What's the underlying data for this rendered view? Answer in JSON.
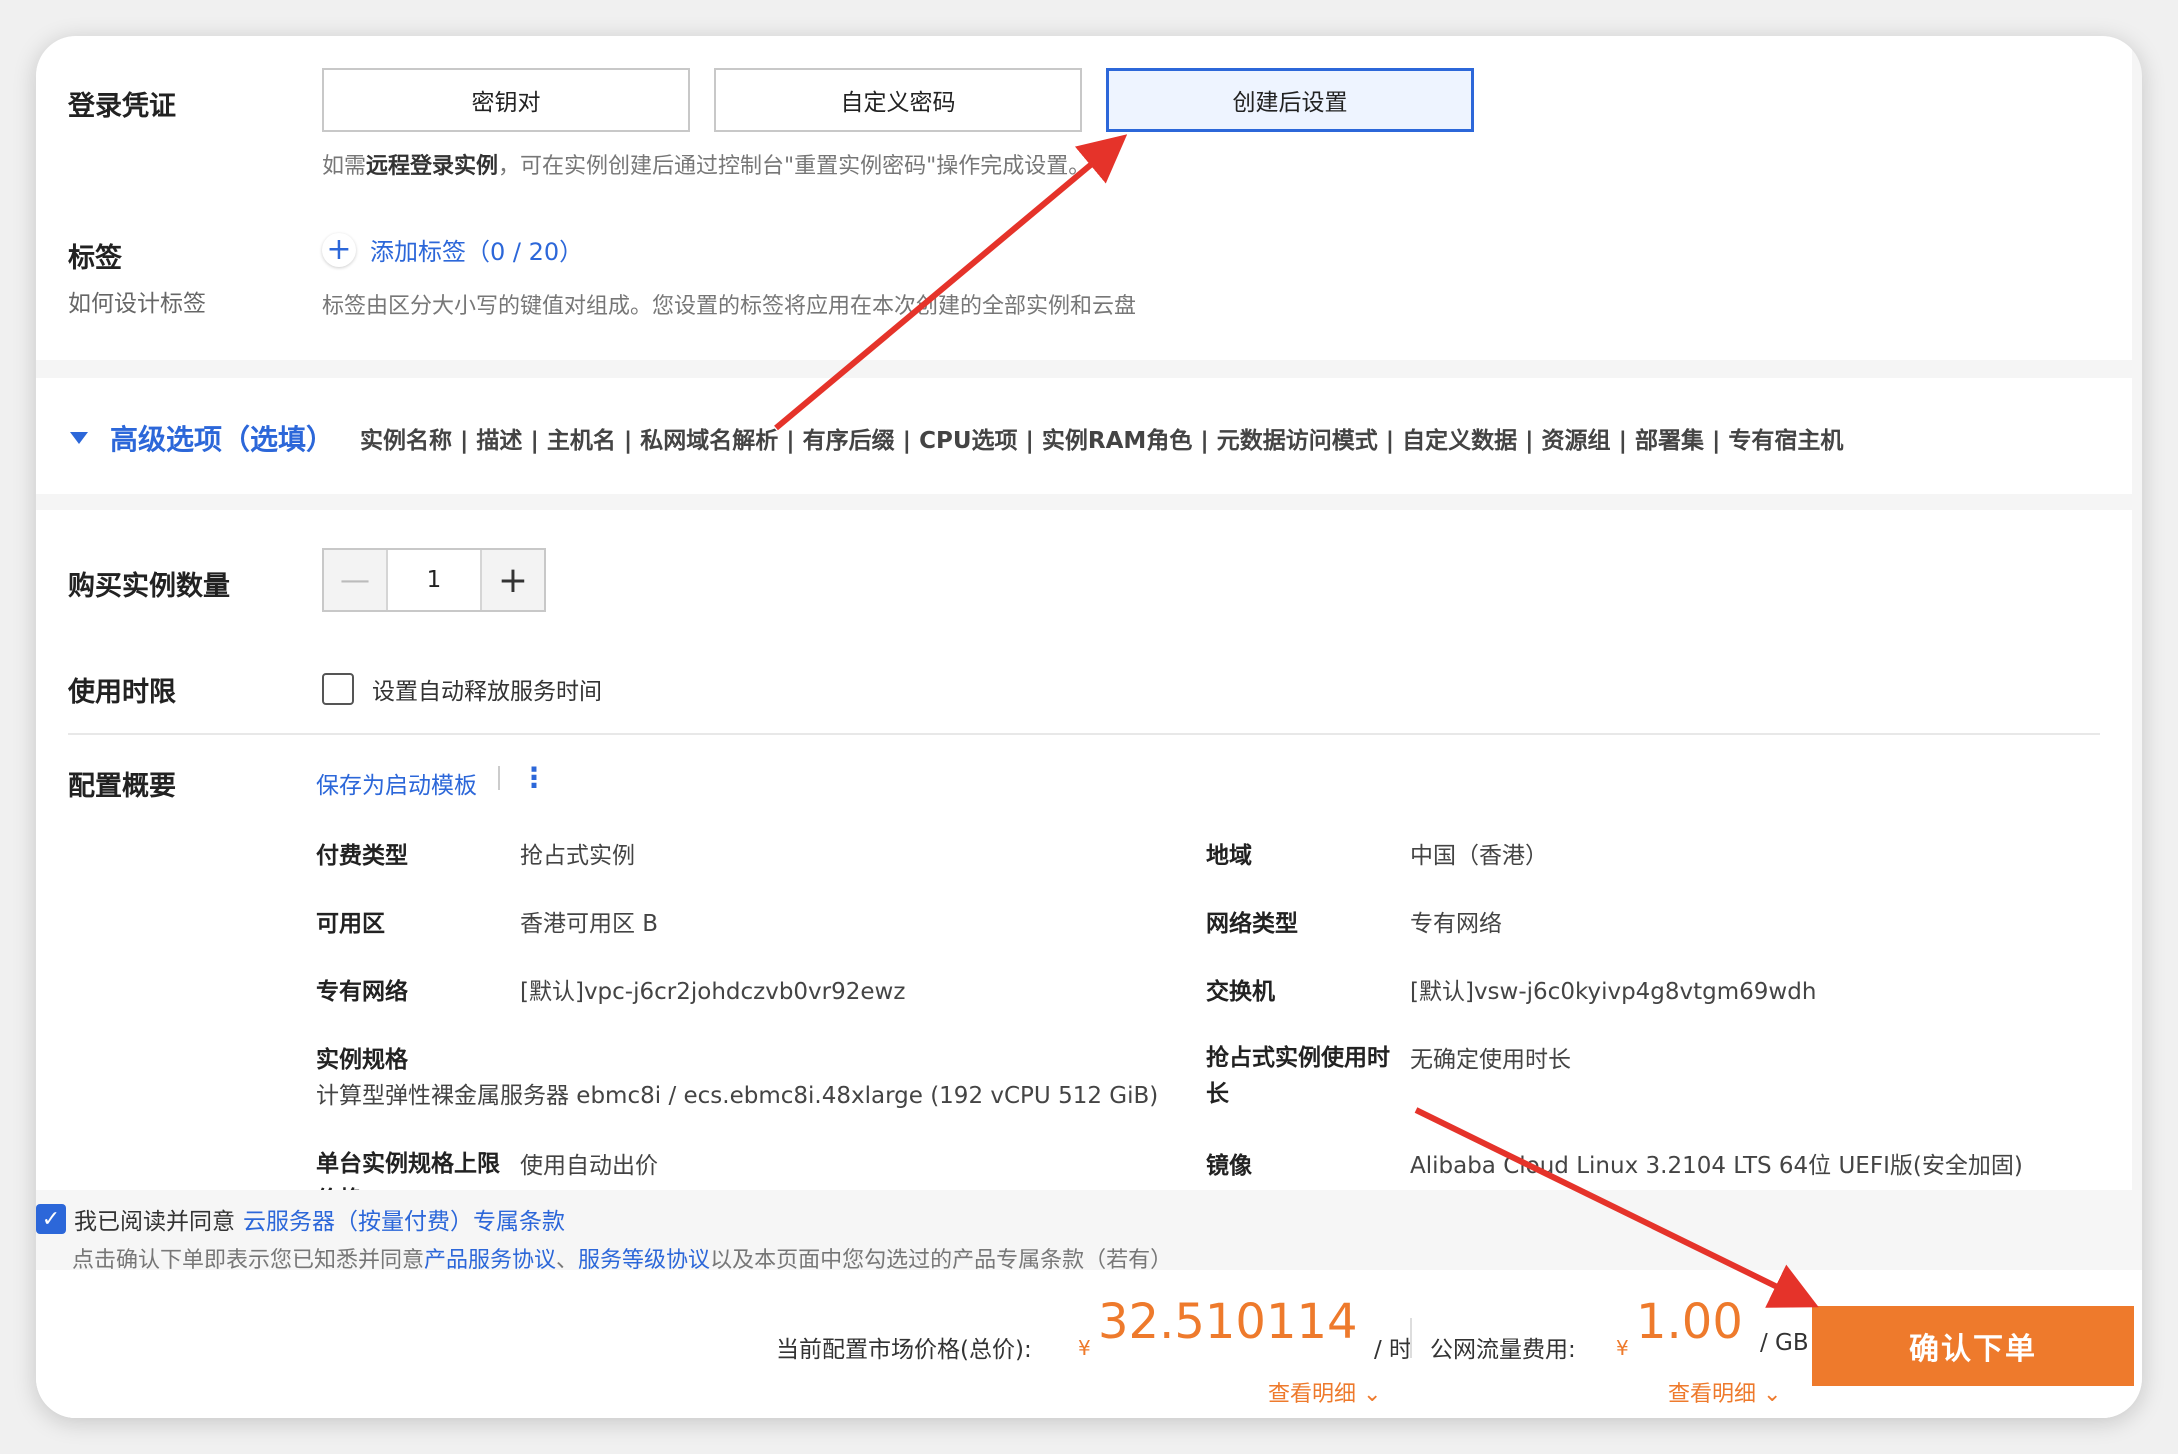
{
  "login": {
    "label": "登录凭证",
    "options": [
      "密钥对",
      "自定义密码",
      "创建后设置"
    ],
    "hint_prefix": "如需",
    "hint_bold": "远程登录实例",
    "hint_suffix": "，可在实例创建后通过控制台\"重置实例密码\"操作完成设置。"
  },
  "tags": {
    "label": "标签",
    "sublabel": "如何设计标签",
    "add_label": "添加标签（0 / 20）",
    "hint": "标签由区分大小写的键值对组成。您设置的标签将应用在本次创建的全部实例和云盘"
  },
  "advanced": {
    "title": "高级选项（选填）",
    "items": "实例名称 | 描述 | 主机名 | 私网域名解析 | 有序后缀 | CPU选项 | 实例RAM角色 | 元数据访问模式 | 自定义数据 | 资源组 | 部署集 | 专有宿主机"
  },
  "quantity": {
    "label": "购买实例数量",
    "value": "1"
  },
  "duration": {
    "label": "使用时限",
    "checkbox_label": "设置自动释放服务时间"
  },
  "summary": {
    "label": "配置概要",
    "save_template": "保存为启动模板",
    "more": "⋮",
    "rows": [
      {
        "k": "付费类型",
        "v": "抢占式实例"
      },
      {
        "k": "地域",
        "v": "中国（香港）"
      },
      {
        "k": "可用区",
        "v": "香港可用区 B"
      },
      {
        "k": "网络类型",
        "v": "专有网络"
      },
      {
        "k": "专有网络",
        "v": "[默认]vpc-j6cr2johdczvb0vr92ewz"
      },
      {
        "k": "交换机",
        "v": "[默认]vsw-j6c0kyivp4g8vtgm69wdh"
      },
      {
        "k": "实例规格",
        "v": "计算型弹性裸金属服务器 ebmc8i / ecs.ebmc8i.48xlarge (192 vCPU 512 GiB)"
      },
      {
        "k": "抢占式实例使用时长",
        "v": "无确定使用时长"
      },
      {
        "k": "单台实例规格上限价格",
        "v": "使用自动出价"
      },
      {
        "k": "镜像",
        "v": "Alibaba Cloud Linux 3.2104 LTS 64位 UEFI版(安全加固)"
      }
    ]
  },
  "agreement": {
    "prefix": "我已阅读并同意",
    "link": "云服务器（按量付费）专属条款",
    "note_prefix": "点击确认下单即表示您已知悉并同意",
    "note_link1": "产品服务协议",
    "note_sep": "、",
    "note_link2": "服务等级协议",
    "note_suffix": "以及本页面中您勾选过的产品专属条款（若有）"
  },
  "footer": {
    "price_label": "当前配置市场价格(总价):",
    "currency": "¥",
    "price": "32.510114",
    "price_unit": "/ 时",
    "traffic_label": "公网流量费用:",
    "traffic_price": "1.00",
    "traffic_unit": "/ GB",
    "detail": "查看明细 ⌄",
    "confirm": "确认下单"
  },
  "colors": {
    "accent": "#2c67d9",
    "orange": "#ee7a2c",
    "arrow": "#e5332a"
  }
}
